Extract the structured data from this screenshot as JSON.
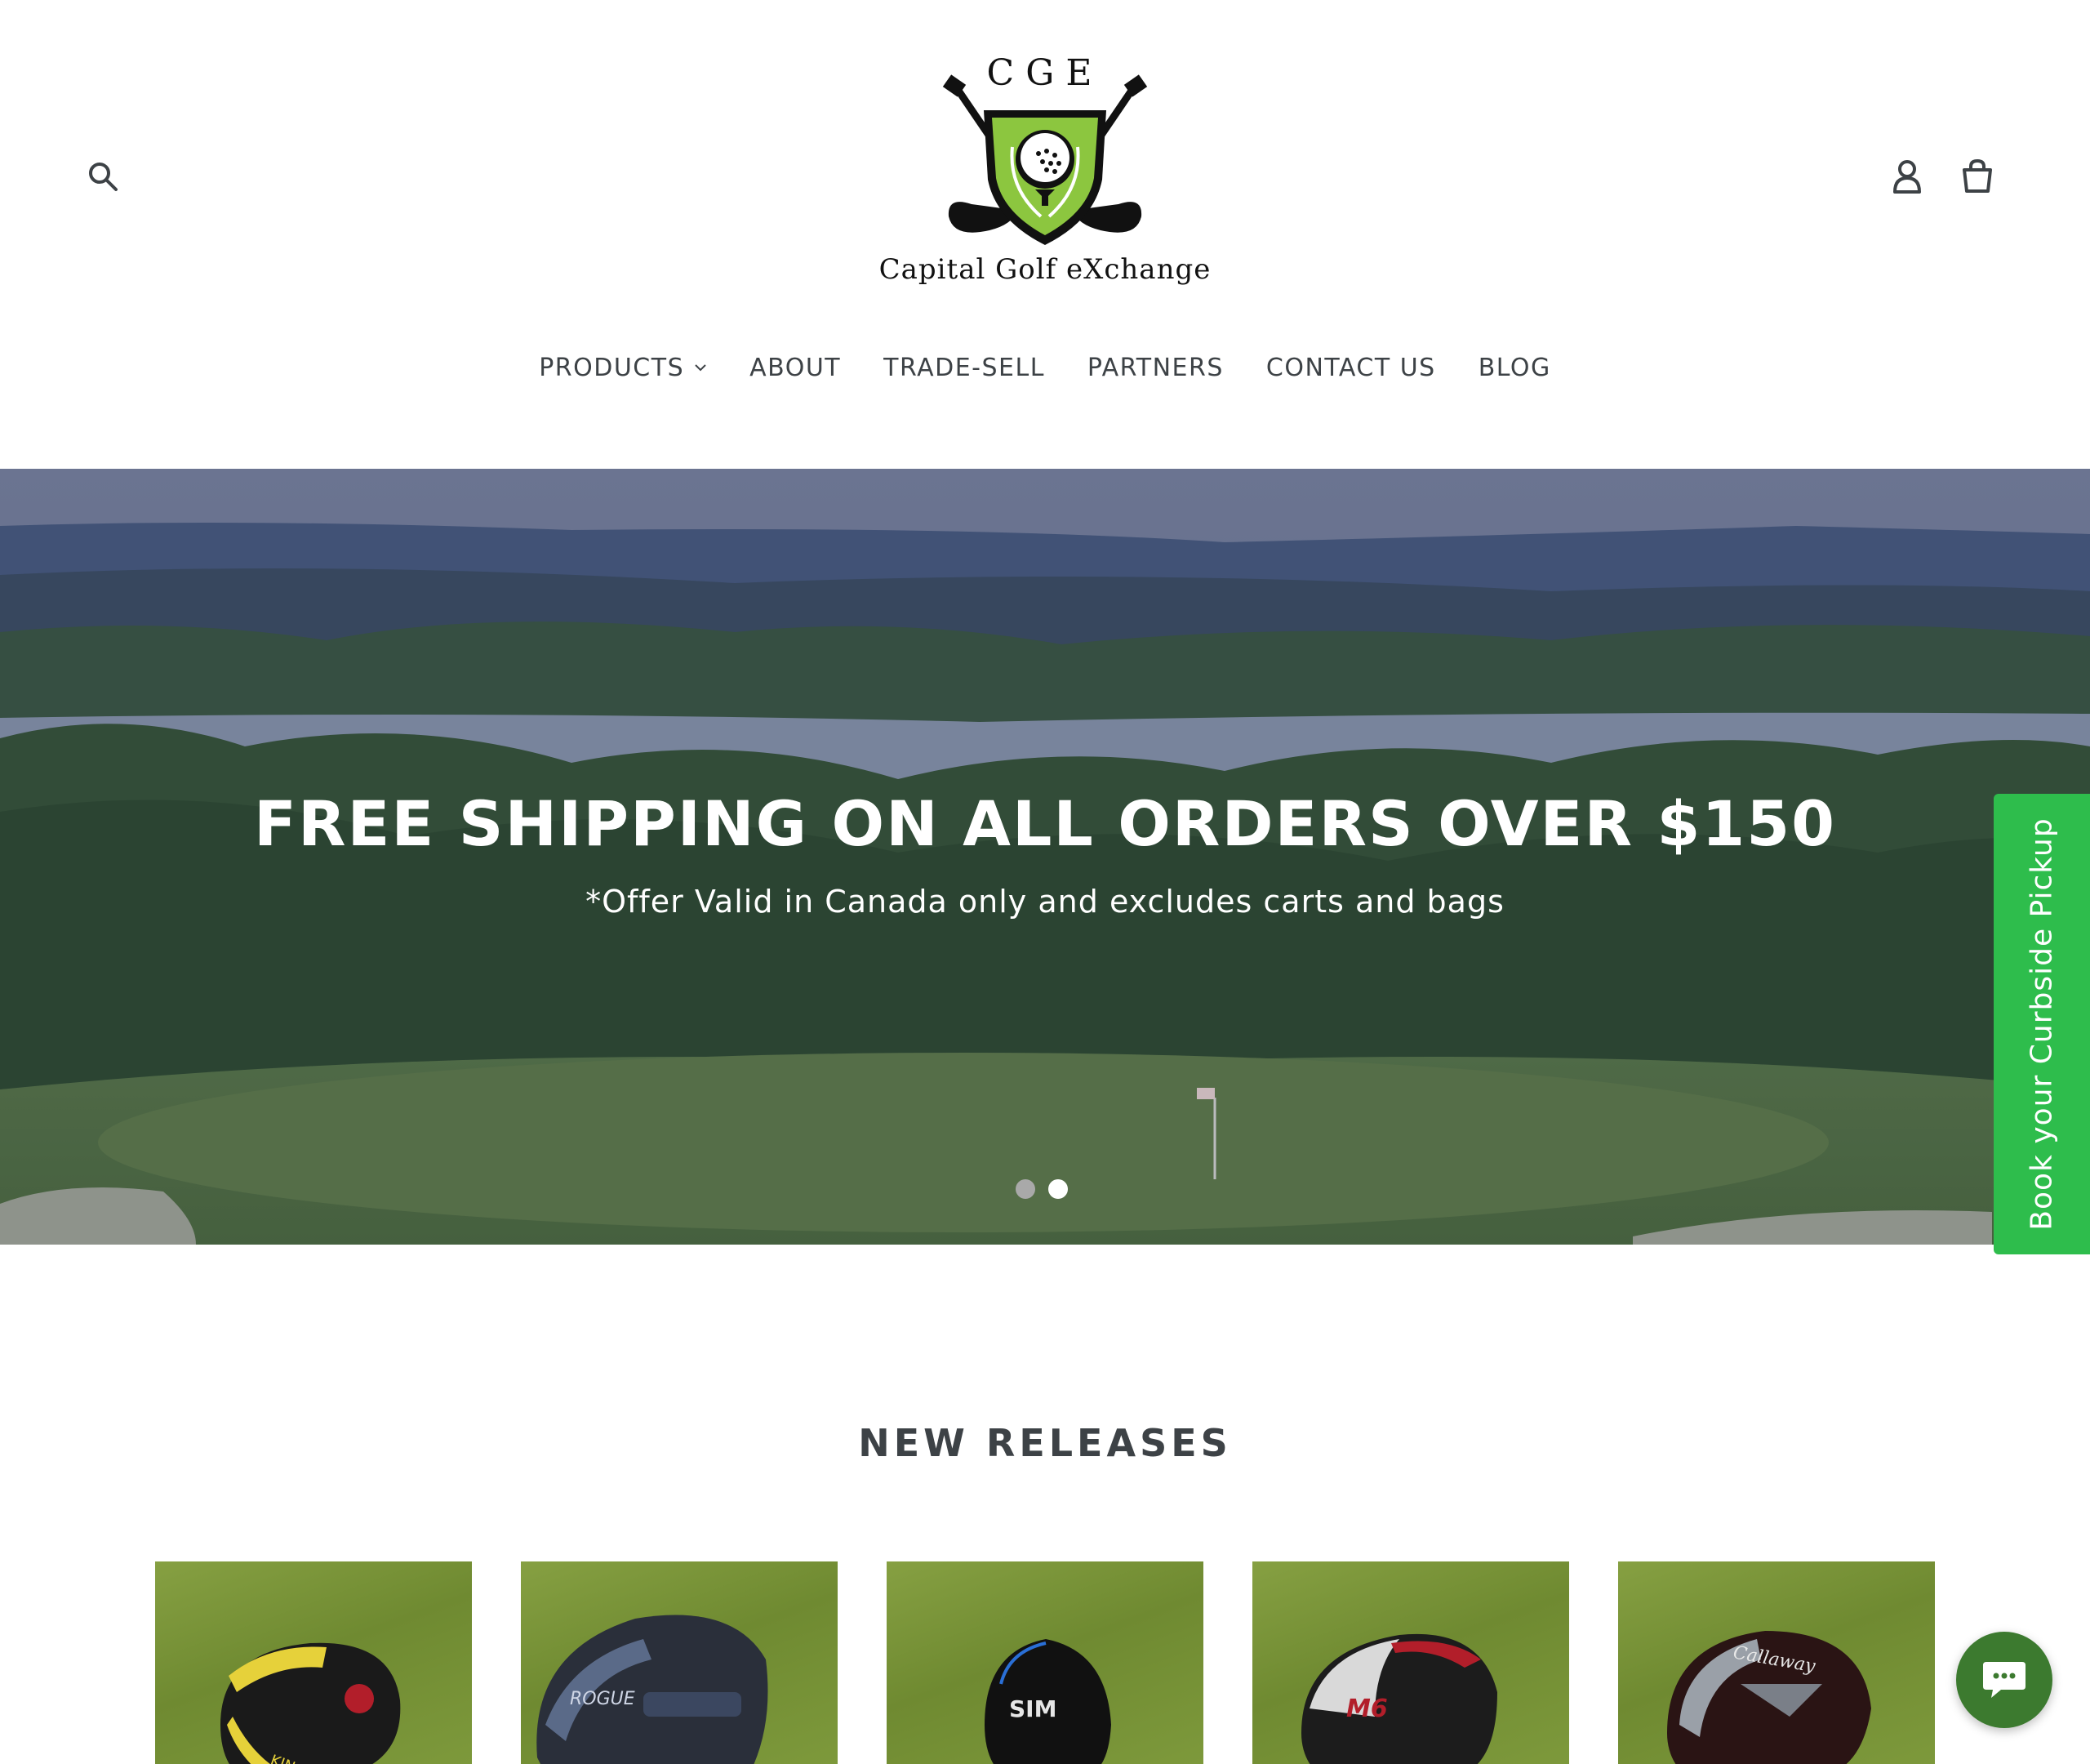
{
  "header": {
    "logo": {
      "initials": "CGE",
      "name": "Capital Golf eXchange"
    },
    "icons": {
      "search": "search-icon",
      "account": "user-icon",
      "cart": "cart-icon"
    }
  },
  "nav": {
    "items": [
      {
        "label": "PRODUCTS",
        "has_dropdown": true
      },
      {
        "label": "ABOUT"
      },
      {
        "label": "TRADE-SELL"
      },
      {
        "label": "PARTNERS"
      },
      {
        "label": "CONTACT US"
      },
      {
        "label": "BLOG"
      }
    ]
  },
  "hero": {
    "title": "FREE SHIPPING ON ALL ORDERS OVER $150",
    "subtitle": "*Offer Valid in Canada only and excludes carts and bags",
    "slides_count": 2,
    "active_slide": 2
  },
  "curbside": {
    "label": "Book your Curbside Pickup",
    "color": "#2ebd4c"
  },
  "new_releases": {
    "title": "NEW RELEASES",
    "products": [
      {
        "badge": "KING",
        "head_color": "#e6d13a"
      },
      {
        "badge": "ROGUE",
        "head_color": "#5a6a88"
      },
      {
        "badge": "SIM",
        "head_color": "#1c1c1c"
      },
      {
        "badge": "M6",
        "head_color": "#b21e2a"
      },
      {
        "badge": "Callaway",
        "head_color": "#3a1a1a"
      }
    ]
  },
  "chat": {
    "icon": "chat-bubble-icon",
    "color": "#3c7a2f"
  },
  "colors": {
    "text": "#3d4246",
    "accent_green": "#2ebd4c",
    "logo_green": "#8cc63f"
  }
}
